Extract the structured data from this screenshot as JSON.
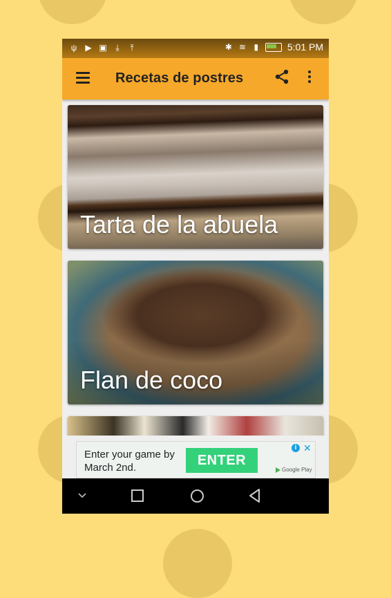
{
  "colors": {
    "background": "#fddc7a",
    "app_bar": "#f6a82a",
    "ad_button": "#33d17a",
    "ad_accent": "#19a0e0"
  },
  "status_bar": {
    "left_icons": [
      "usb-icon",
      "youtube-icon",
      "image-icon",
      "download-icon",
      "upload-icon"
    ],
    "right_icons": [
      "bluetooth-icon",
      "wifi-icon",
      "sim-icon",
      "battery-charging-icon"
    ],
    "time": "5:01 PM"
  },
  "app_bar": {
    "title": "Recetas de postres",
    "icons": [
      "menu-icon",
      "share-icon",
      "more-vert-icon"
    ]
  },
  "recipes": [
    {
      "label": "Tarta de la abuela"
    },
    {
      "label": "Flan de coco"
    }
  ],
  "ad": {
    "text": "Enter your game by March 2nd.",
    "button": "ENTER",
    "brand": "Google Play"
  },
  "nav_bar": {
    "icons": [
      "chevron-down-icon",
      "recents-icon",
      "home-icon",
      "back-icon"
    ]
  }
}
